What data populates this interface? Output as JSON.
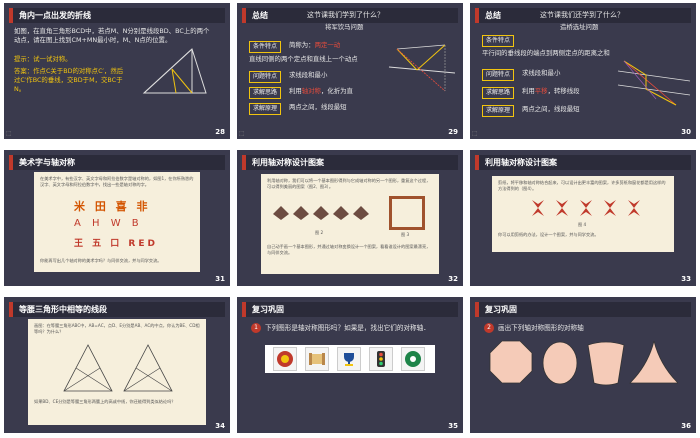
{
  "slides": [
    {
      "title": "角内一点出发的折线",
      "num": "28",
      "body": "如图，在直角三角形BCD中，若点M、N分别是线段BD、BC上的两个动点，请在图上找到CM+MN最小时，M、N点的位置。",
      "hint": "提示：试一试对称。",
      "answer": "答案：作点C关于BD的对称点C′，然后过C′作BC的垂线，交BD于M，交BC于N。"
    },
    {
      "title": "总结",
      "num": "29",
      "question": "这节课我们学到了什么？",
      "subtitle": "将军饮马问题",
      "rows": [
        {
          "tag": "条件特点",
          "text": "简称为：两定一动"
        },
        {
          "tag": "",
          "text": "直线同侧的两个定点和直线上一个动点"
        },
        {
          "tag": "问题特点",
          "text": "求线段和最小"
        },
        {
          "tag": "求解思路",
          "text": "利用轴对称，化折为直"
        },
        {
          "tag": "求解原理",
          "text": "两点之间，线段最短"
        }
      ]
    },
    {
      "title": "总结",
      "num": "30",
      "question": "这节课我们还学到了什么？",
      "subtitle": "造桥选址问题",
      "rows": [
        {
          "tag": "条件特点",
          "text": ""
        },
        {
          "tag": "",
          "text": "平行间的垂线段的端点到两侧定点的距离之和"
        },
        {
          "tag": "问题特点",
          "text": "求线段和最小"
        },
        {
          "tag": "求解思路",
          "text": "利用平移，转移线段"
        },
        {
          "tag": "求解原理",
          "text": "两点之间，线段最短"
        }
      ]
    },
    {
      "title": "美术字与轴对称",
      "num": "31",
      "paper_text": "在美术字中，有些汉字、英文字母和阿拉伯数字是轴对称的，如图1，在你所熟悉的汉字、英文字母和阿拉伯数字中，找出一些是轴对称的字。",
      "row1": "米 田 喜 非",
      "row2": "A H W B",
      "row3": "王 五 口 RED",
      "question": "你能再写出几个轴对称的美术字吗？与同伴交流，并与同学交流。"
    },
    {
      "title": "利用轴对称设计图案",
      "num": "32",
      "paper_text": "利用轴对称，我们可以将一个基本图形得到与它成轴对称的另一个图形，重复这个过程，可以得到美丽的图案（图2、图3）。",
      "fig1": "图 2",
      "fig2": "图 3",
      "paper_text2": "自己动手画一个基本图形，并通过轴对称变换设计一个图案，看看谁设计的图案最漂亮，与同伴交流。"
    },
    {
      "title": "利用轴对称设计图案",
      "num": "33",
      "paper_text": "剪纸，将平移和轴对称结合起来，可以设计出更丰富的图案，许多剪纸和窗花都是用这样的方法得到的（图4）。",
      "fig": "图 4",
      "paper_text2": "你可以用剪纸的办法，设计一个图案，并与同学交流。"
    },
    {
      "title": "等腰三角形中相等的线段",
      "num": "34",
      "paper_text": "画图：在等腰三角形ABC中，AB=AC，点D、E分别是AB、AC的中点，你认为BE、CD相等吗？为什么？",
      "paper_text2": "如果BD、CE分别是等腰三角形两腰上的高或中线，你还能得到类似结论吗？"
    },
    {
      "title": "复习巩固",
      "num": "35",
      "badge": "1",
      "question": "下列图形是轴对称图形吗？如果是，找出它们的对称轴．"
    },
    {
      "title": "复习巩固",
      "num": "36",
      "badge": "2",
      "question": "画出下列轴对称图形的对称轴"
    }
  ],
  "icons": [
    "emblem-icon",
    "scroll-icon",
    "trophy-icon",
    "traffic-light-icon",
    "flower-logo-icon"
  ],
  "shapes": [
    "octagon-shape",
    "ellipse-shape",
    "cup-shape",
    "triangle-shape"
  ],
  "colors": {
    "slide_bg": "#3a3a4d",
    "accent": "#c0392b",
    "highlight": "#f1c40f",
    "paper": "#f6efdc"
  }
}
